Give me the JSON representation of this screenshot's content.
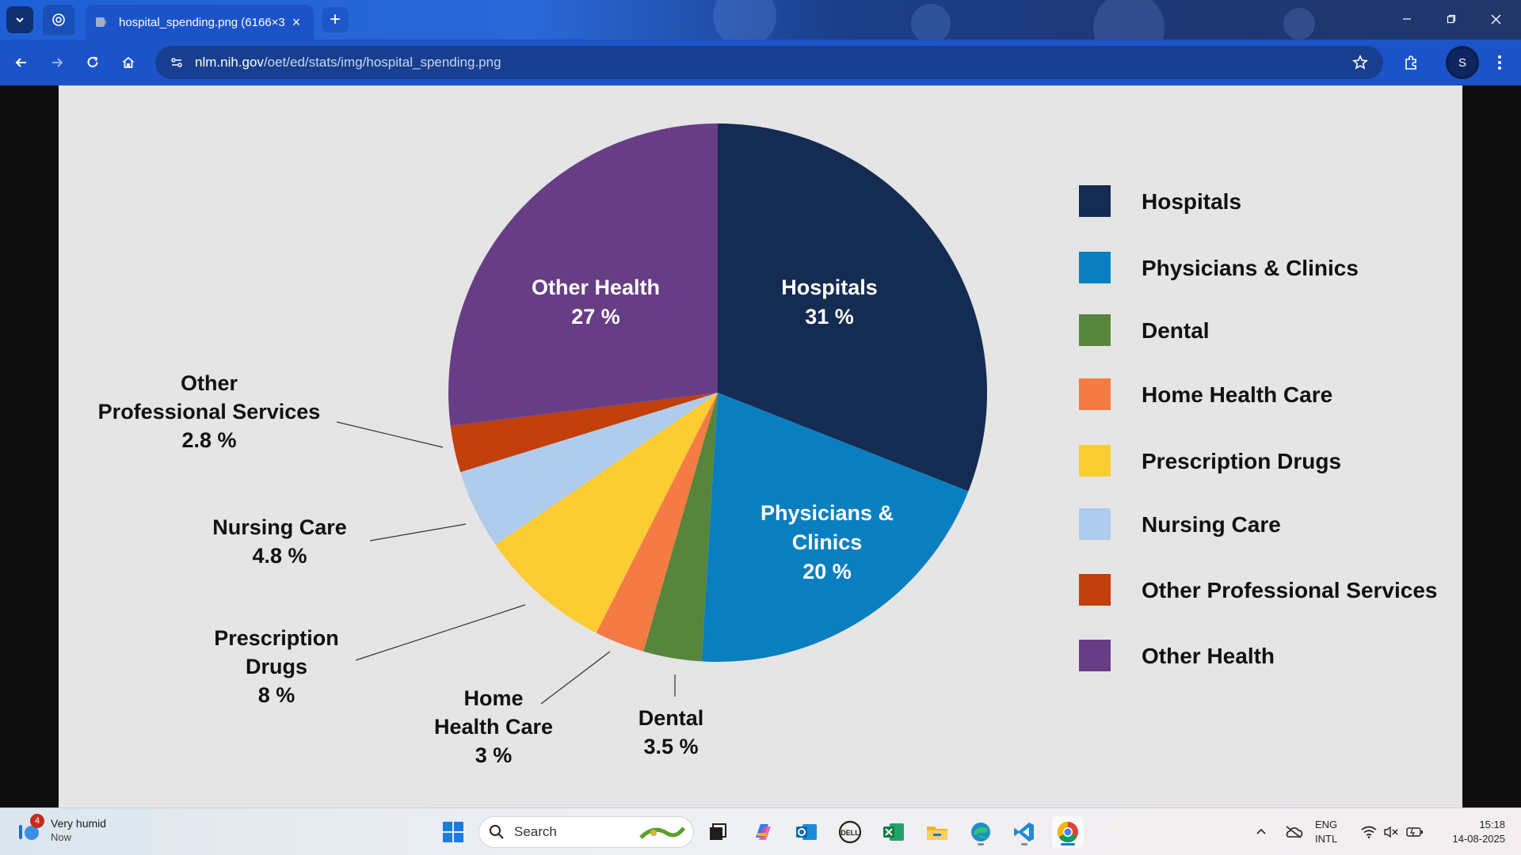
{
  "browser": {
    "tab_title": "hospital_spending.png (6166×3",
    "url_host": "nlm.nih.gov",
    "url_path": "/oet/ed/stats/img/hospital_spending.png",
    "profile_initial": "S"
  },
  "chart_data": {
    "type": "pie",
    "title": "",
    "slices": [
      {
        "label": "Hospitals",
        "value": 31,
        "value_text": "31 %",
        "color": "#142b52"
      },
      {
        "label": "Physicians & Clinics",
        "value": 20,
        "value_text": "20 %",
        "color": "#0a7fc0"
      },
      {
        "label": "Dental",
        "value": 3.5,
        "value_text": "3.5 %",
        "color": "#57853c"
      },
      {
        "label": "Home Health Care",
        "value": 3,
        "value_text": "3 %",
        "color": "#f47c44"
      },
      {
        "label": "Prescription Drugs",
        "value": 8,
        "value_text": "8 %",
        "color": "#fccc33"
      },
      {
        "label": "Nursing Care",
        "value": 4.8,
        "value_text": "4.8 %",
        "color": "#b0ccec"
      },
      {
        "label": "Other Professional Services",
        "value": 2.8,
        "value_text": "2.8 %",
        "color": "#c13f0b"
      },
      {
        "label": "Other Health",
        "value": 27,
        "value_text": "27 %",
        "color": "#673e86"
      }
    ],
    "inner_labels": {
      "hospitals": [
        "Hospitals",
        "31 %"
      ],
      "physicians": [
        "Physicians &",
        "Clinics",
        "20 %"
      ],
      "other_health": [
        "Other Health",
        "27 %"
      ]
    },
    "callouts": {
      "other_prof": [
        "Other",
        "Professional Services",
        "2.8 %"
      ],
      "nursing": [
        "Nursing Care",
        "4.8 %"
      ],
      "rx": [
        "Prescription",
        "Drugs",
        "8 %"
      ],
      "home": [
        "Home",
        "Health Care",
        "3 %"
      ],
      "dental": [
        "Dental",
        "3.5 %"
      ]
    },
    "legend_placement": "right"
  },
  "taskbar": {
    "weather_line1": "Very humid",
    "weather_line2": "Now",
    "weather_badge": "4",
    "search_placeholder": "Search",
    "lang_line1": "ENG",
    "lang_line2": "INTL",
    "time": "15:18",
    "date": "14-08-2025"
  },
  "icons": [
    "tab-search-icon",
    "chatgpt-icon",
    "close-icon",
    "plus-icon",
    "minimize-icon",
    "restore-icon",
    "window-close-icon",
    "back-icon",
    "forward-icon",
    "reload-icon",
    "home-icon",
    "site-info-icon",
    "star-icon",
    "extensions-icon",
    "menu-dots-icon",
    "windows-start-icon",
    "search-icon",
    "task-view-icon",
    "copilot-icon",
    "outlook-icon",
    "dell-icon",
    "excel-icon",
    "file-explorer-icon",
    "edge-icon",
    "vscode-icon",
    "chrome-icon",
    "chevron-up-icon",
    "onedrive-icon",
    "wifi-icon",
    "speaker-muted-icon",
    "battery-icon"
  ]
}
